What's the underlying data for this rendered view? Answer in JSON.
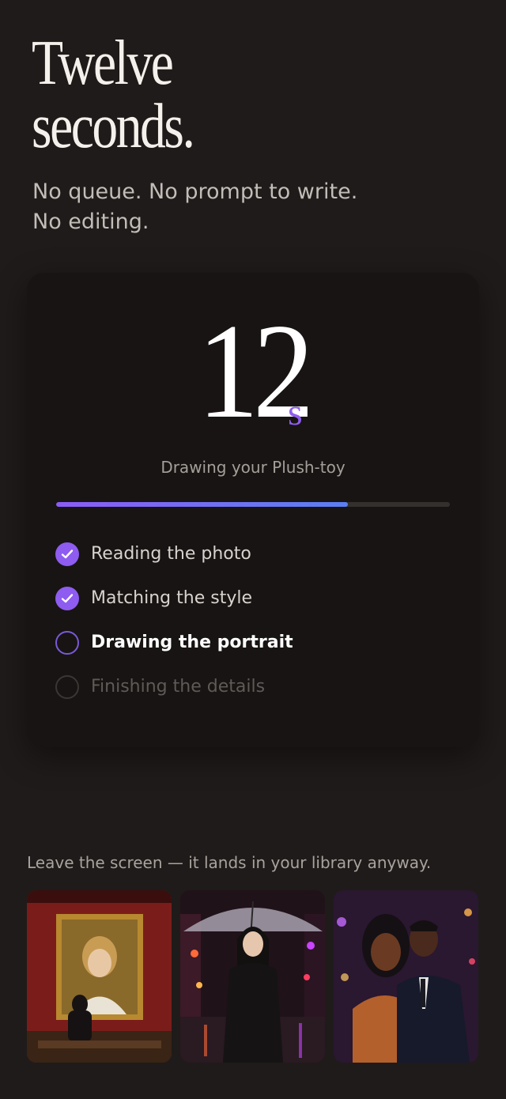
{
  "headline": {
    "line1": "Twelve",
    "line2": "seconds."
  },
  "subhead": {
    "line1": "No queue. No prompt to write.",
    "line2": "No editing."
  },
  "timer": {
    "value": "12",
    "unit": "s"
  },
  "status_text": "Drawing your Plush-toy",
  "progress": {
    "fraction": 0.74
  },
  "steps": [
    {
      "label": "Reading the photo",
      "state": "done"
    },
    {
      "label": "Matching the style",
      "state": "done"
    },
    {
      "label": "Drawing the portrait",
      "state": "active"
    },
    {
      "label": "Finishing the details",
      "state": "pending"
    }
  ],
  "note": "Leave the screen — it lands in your library anyway.",
  "gallery": [
    {
      "icon": "gallery-portrait-image"
    },
    {
      "icon": "rainy-street-umbrella-image"
    },
    {
      "icon": "couple-evening-image"
    }
  ],
  "colors": {
    "accent": "#8e5cf0",
    "accent_blue": "#5b7ff2",
    "background": "#1f1b1a",
    "card": "#171413"
  }
}
